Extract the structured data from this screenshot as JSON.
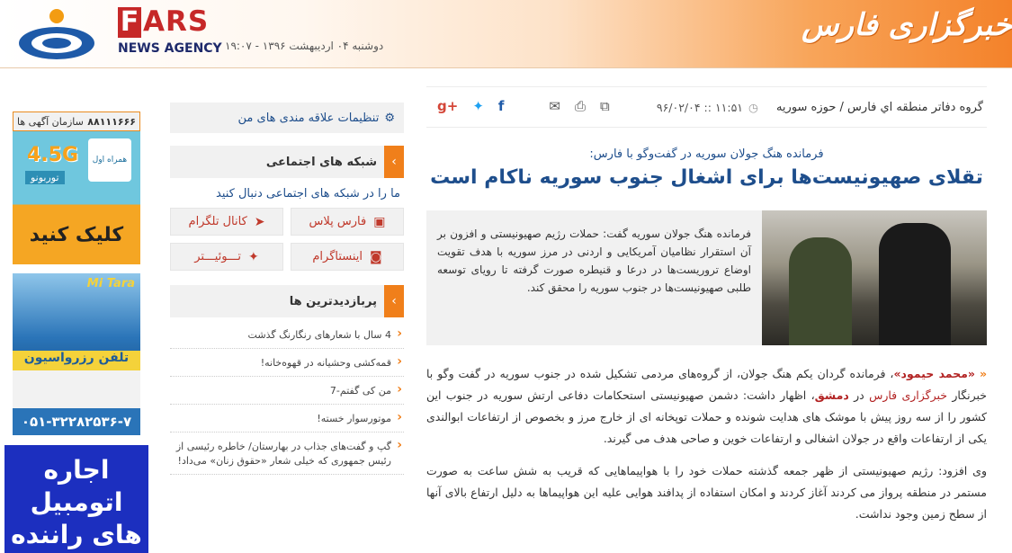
{
  "header": {
    "brand_letter": "F",
    "brand_rest": "ARS",
    "brand_sub": "NEWS AGENCY",
    "date": "دوشنبه ۰۴ اردیبهشت ۱۳۹۶ - ۱۹:۰۷",
    "fa_logo": "خبرگزاری فارس"
  },
  "ads": {
    "ad1_top_left": "سازمان آگهی ها",
    "ad1_top_right": "۸۸۱۱۱۶۶۶",
    "ad1_badge": "4.5G",
    "ad1_sub": "توربونو",
    "ad1_logo": "همراه اول",
    "ad1_cta": "کلیک کنید",
    "ad2_brand": "Mi Tara",
    "ad2_band": "تلفن رزرواسیون",
    "ad2_phone": "۰۵۱-۳۲۲۸۲۵۳۶-۷",
    "ad3_text": "اجاره اتومبیل های راننده بدون"
  },
  "sidebar": {
    "settings_label": "تنظیمات علاقه مندی های من",
    "social_head": "شبکه های اجتماعی",
    "follow_text": "ما را در شبکه های اجتماعی دنبال کنید",
    "social": [
      {
        "label": "فارس پلاس",
        "icon": "fars-plus-icon",
        "glyph": "▣"
      },
      {
        "label": "کانال تلگرام",
        "icon": "telegram-icon",
        "glyph": "➤"
      },
      {
        "label": "اینستاگرام",
        "icon": "instagram-icon",
        "glyph": "◙"
      },
      {
        "label": "تـــوئیـــتر",
        "icon": "twitter-icon",
        "glyph": "✦"
      }
    ],
    "popular_head": "پربازدیدترین ها",
    "popular": [
      "4 سال با شعارهای رنگارنگ گذشت",
      "قمه‌کشی وحشیانه در قهوه‌خانه!",
      "من کی گفتم-7",
      "موتورسوار خسته!",
      "گپ و گفت‌های جذاب در بهارستان/ خاطره رئیسی از رئیس جمهوری که خیلی شعار «حقوق زنان» می‌داد!"
    ]
  },
  "article": {
    "breadcrumb": "گروه دفاتر منطقه اي فارس / حوزه سوريه",
    "time": "۱۱:۵۱ :: ۹۶/۰۲/۰۴",
    "lead_sub": "فرمانده هنگ جولان سوریه در گفت‌وگو با فارس:",
    "title": "تقلای صهیونیست‌ها برای اشغال جنوب سوریه ناکام است",
    "lead": "فرمانده هنگ جولان سوریه گفت: حملات رژیم صهیونیستی و افزون بر آن استقرار نظامیان آمریکایی و اردنی در مرز سوریه با هدف تقویت اوضاع تروریست‌ها در درعا و قنیطره صورت گرفته تا رویای توسعه طلبی صهیونیست‌ها در جنوب سوریه را محقق کند.",
    "p1_name": "«محمد حیمود»",
    "p1_a": "، فرمانده گردان یکم هنگ جولان، از گروه‌های مردمی تشکیل شده در جنوب سوریه در گفت وگو با خبرنگار ",
    "p1_link": "خبرگزاری فارس",
    "p1_b": " در ",
    "p1_city": "دمشق",
    "p1_c": "، اظهار داشت: دشمن صهیونیستی استحکامات دفاعی ارتش سوریه در جنوب این کشور را از سه روز پیش با موشک های هدایت شونده و حملات توپخانه ای از خارج مرز و بخصوص از ارتفاعات ابوالندی یکی از ارتفاعات واقع در جولان اشغالی و ارتفاعات خوین و صاحی هدف می گیرند.",
    "p2": "وی افزود: رژیم صهیونیستی از ظهر جمعه گذشته حملات خود را با هواپیماهایی که قریب به شش ساعت به صورت مستمر در منطقه پرواز می کردند آغاز کردند و امکان استفاده از پدافند هوایی علیه این هواپیماها به دلیل ارتفاع بالای آنها از سطح زمین وجود نداشت."
  },
  "colors": {
    "brand_red": "#c62828",
    "accent_orange": "#f07f1a",
    "link_blue": "#1e4e8c"
  }
}
